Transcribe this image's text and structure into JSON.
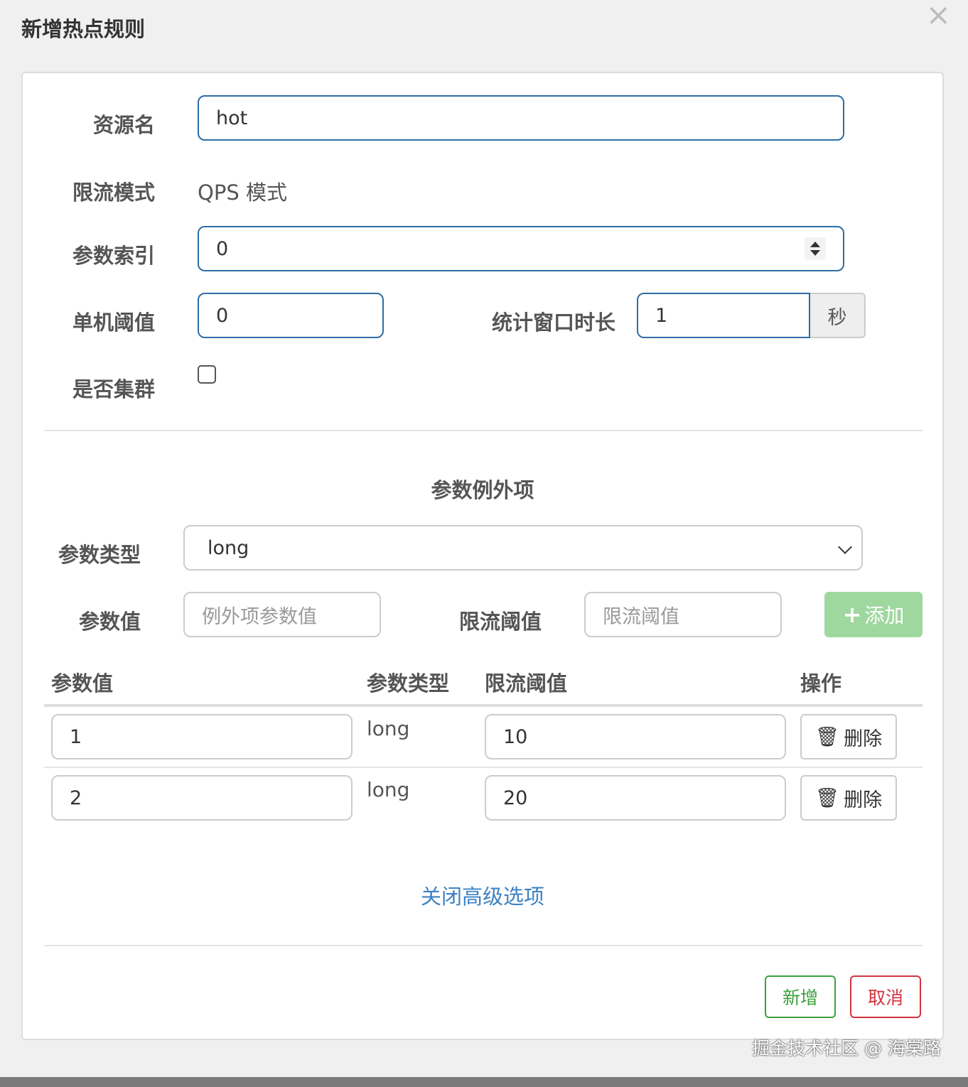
{
  "modal": {
    "title": "新增热点规则",
    "close_icon": "close-icon"
  },
  "form": {
    "resource_label": "资源名",
    "resource_value": "hot",
    "mode_label": "限流模式",
    "mode_value": "QPS 模式",
    "param_index_label": "参数索引",
    "param_index_value": "0",
    "single_threshold_label": "单机阈值",
    "single_threshold_value": "0",
    "window_label": "统计窗口时长",
    "window_value": "1",
    "window_unit": "秒",
    "cluster_label": "是否集群",
    "cluster_checked": false
  },
  "exceptions": {
    "section_title": "参数例外项",
    "param_type_label": "参数类型",
    "param_type_value": "long",
    "param_value_label": "参数值",
    "param_value_placeholder": "例外项参数值",
    "limit_label": "限流阈值",
    "limit_placeholder": "限流阈值",
    "add_button": "添加",
    "table": {
      "headers": [
        "参数值",
        "参数类型",
        "限流阈值",
        "操作"
      ],
      "rows": [
        {
          "value": "1",
          "type": "long",
          "limit": "10",
          "action": "删除"
        },
        {
          "value": "2",
          "type": "long",
          "limit": "20",
          "action": "删除"
        }
      ]
    },
    "toggle_link": "关闭高级选项"
  },
  "footer": {
    "ok_button": "新增",
    "cancel_button": "取消"
  },
  "watermark": "掘金技术社区 @ 海棠路",
  "colors": {
    "primary_border": "#2e6da4",
    "success": "#3aa13a",
    "danger": "#d2333f",
    "add_button_bg": "#9fd89f",
    "link": "#3b82c4"
  }
}
